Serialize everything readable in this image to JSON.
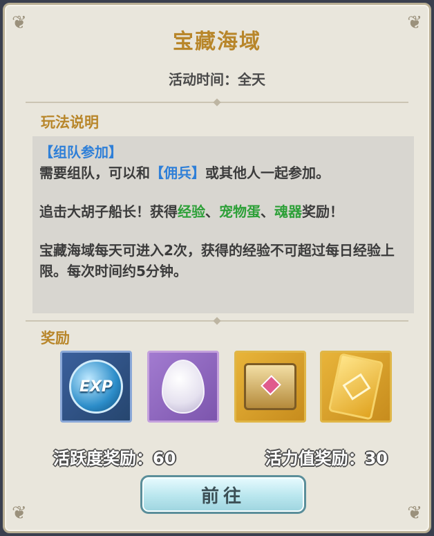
{
  "dialog": {
    "title": "宝藏海域",
    "time_label": "活动时间：全天"
  },
  "howto": {
    "heading": "玩法说明",
    "tag": "【组队参加】",
    "line1_pre": "需要组队，可以和",
    "line1_tag": "【佣兵】",
    "line1_post": "或其他人一起参加。",
    "line2_pre": "追击大胡子船长！获得",
    "line2_hl1": "经验",
    "line2_sep1": "、",
    "line2_hl2": "宠物蛋",
    "line2_sep2": "、",
    "line2_hl3": "魂器",
    "line2_post": "奖励！",
    "line3": "宝藏海域每天可进入2次，获得的经验不可超过每日经验上限。每次时间约5分钟。"
  },
  "rewards": {
    "heading": "奖励",
    "items": [
      {
        "icon": "exp-orb-icon",
        "label": "EXP"
      },
      {
        "icon": "pet-egg-icon"
      },
      {
        "icon": "treasure-chest-icon"
      },
      {
        "icon": "soul-card-icon"
      }
    ]
  },
  "stats": {
    "activity": "活跃度奖励：60",
    "vitality": "活力值奖励：30"
  },
  "actions": {
    "go_label": "前往"
  },
  "colors": {
    "title_gold": "#b8862a",
    "tag_blue": "#2e7fd8",
    "highlight_green": "#2da038"
  }
}
